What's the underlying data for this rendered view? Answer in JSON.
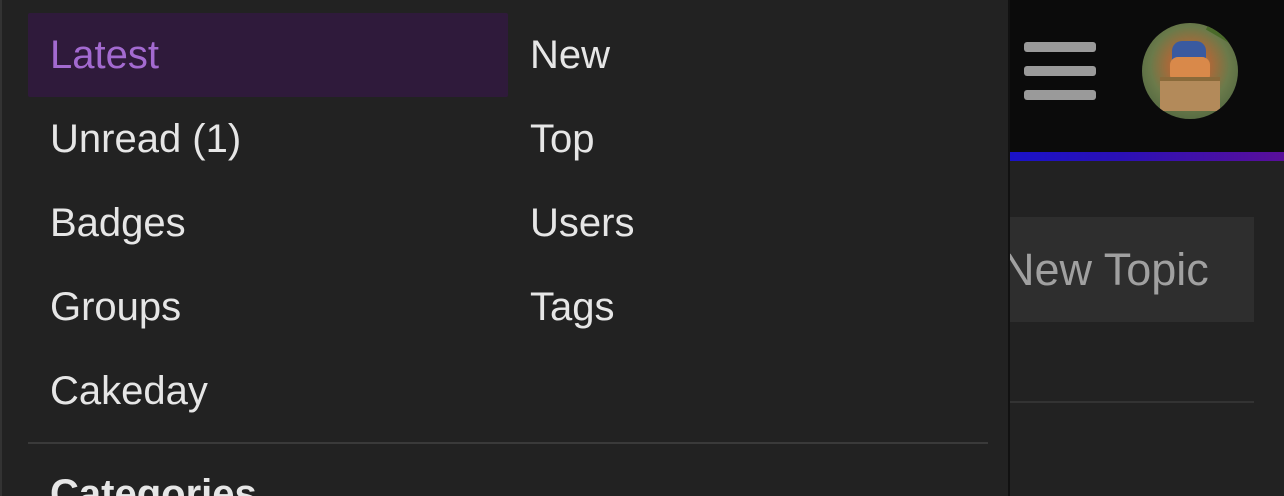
{
  "header": {
    "menu_icon": "hamburger-icon",
    "avatar": "user-avatar"
  },
  "main": {
    "new_topic_label": "New Topic"
  },
  "menu": {
    "left": [
      {
        "label": "Latest",
        "active": true
      },
      {
        "label": "Unread (1)"
      },
      {
        "label": "Badges"
      },
      {
        "label": "Groups"
      },
      {
        "label": "Cakeday"
      }
    ],
    "right": [
      {
        "label": "New"
      },
      {
        "label": "Top"
      },
      {
        "label": "Users"
      },
      {
        "label": "Tags"
      }
    ],
    "section_heading": "Categories"
  },
  "colors": {
    "accent": "#a36ad0",
    "active_bg": "#2f1a3b",
    "panel_bg": "#222222",
    "header_bg": "#0b0b0b"
  }
}
